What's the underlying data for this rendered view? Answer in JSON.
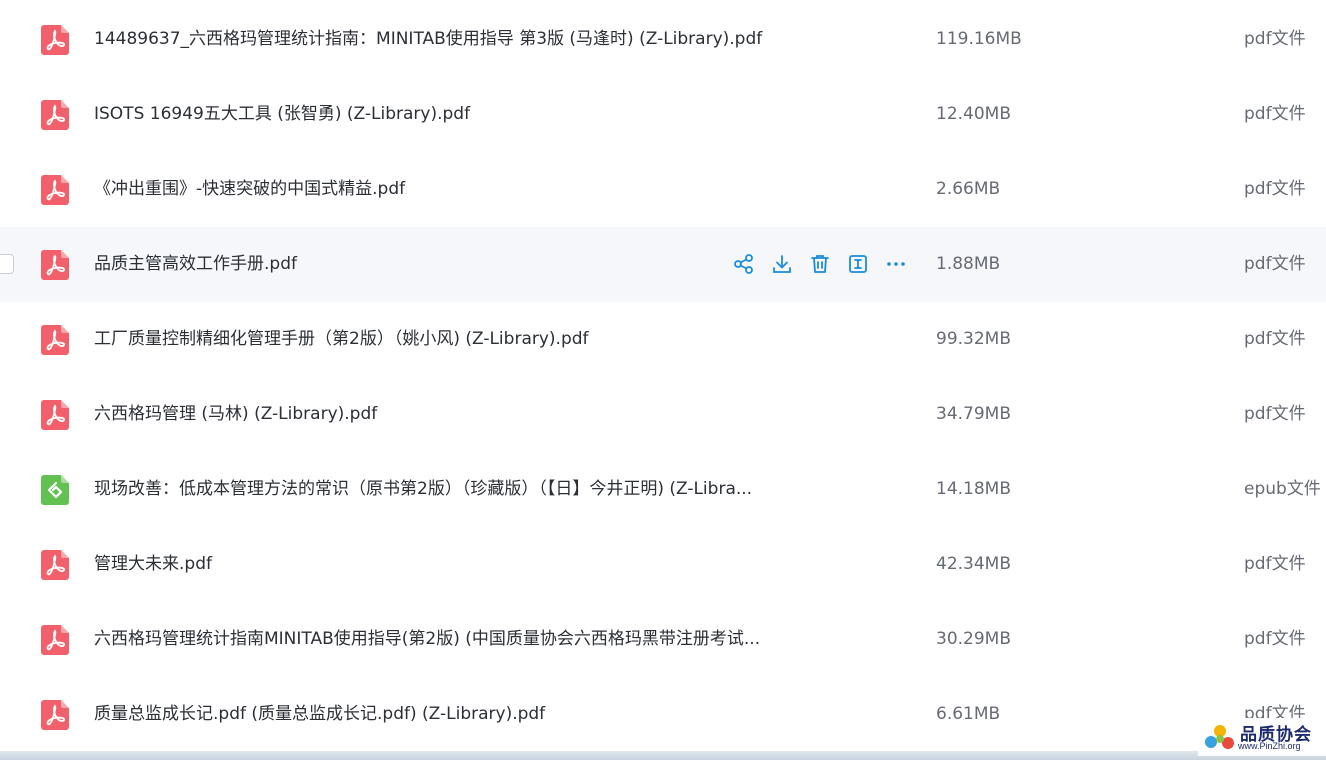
{
  "files": [
    {
      "name": "14489637_六西格玛管理统计指南：MINITAB使用指导 第3版 (马逢时) (Z-Library).pdf",
      "size": "119.16MB",
      "type": "pdf文件",
      "icon": "pdf-icon"
    },
    {
      "name": "ISOTS 16949五大工具 (张智勇) (Z-Library).pdf",
      "size": "12.40MB",
      "type": "pdf文件",
      "icon": "pdf-icon"
    },
    {
      "name": "《冲出重围》-快速突破的中国式精益.pdf",
      "size": "2.66MB",
      "type": "pdf文件",
      "icon": "pdf-icon"
    },
    {
      "name": "品质主管高效工作手册.pdf",
      "size": "1.88MB",
      "type": "pdf文件",
      "icon": "pdf-icon",
      "hovered": true
    },
    {
      "name": "工厂质量控制精细化管理手册（第2版）（姚小风) (Z-Library).pdf",
      "size": "99.32MB",
      "type": "pdf文件",
      "icon": "pdf-icon"
    },
    {
      "name": "六西格玛管理 (马林) (Z-Library).pdf",
      "size": "34.79MB",
      "type": "pdf文件",
      "icon": "pdf-icon"
    },
    {
      "name": "现场改善：低成本管理方法的常识（原书第2版）（珍藏版）（【日】今井正明) (Z-Libra...",
      "size": "14.18MB",
      "type": "epub文件",
      "icon": "epub-icon"
    },
    {
      "name": "管理大未来.pdf",
      "size": "42.34MB",
      "type": "pdf文件",
      "icon": "pdf-icon"
    },
    {
      "name": "六西格玛管理统计指南MINITAB使用指导(第2版) (中国质量协会六西格玛黑带注册考试...",
      "size": "30.29MB",
      "type": "pdf文件",
      "icon": "pdf-icon"
    },
    {
      "name": "质量总监成长记.pdf (质量总监成长记.pdf) (Z-Library).pdf",
      "size": "6.61MB",
      "type": "pdf文件",
      "icon": "pdf-icon"
    }
  ],
  "row_actions": [
    "share-icon",
    "download-icon",
    "delete-icon",
    "rename-icon",
    "more-icon"
  ],
  "colors": {
    "pdf": "#f2616b",
    "epub": "#63c152",
    "action": "#1b8be0",
    "hover_bg": "#f5f7fb"
  },
  "watermark": {
    "title": "品质协会",
    "url": "www.PinZhi.org"
  }
}
